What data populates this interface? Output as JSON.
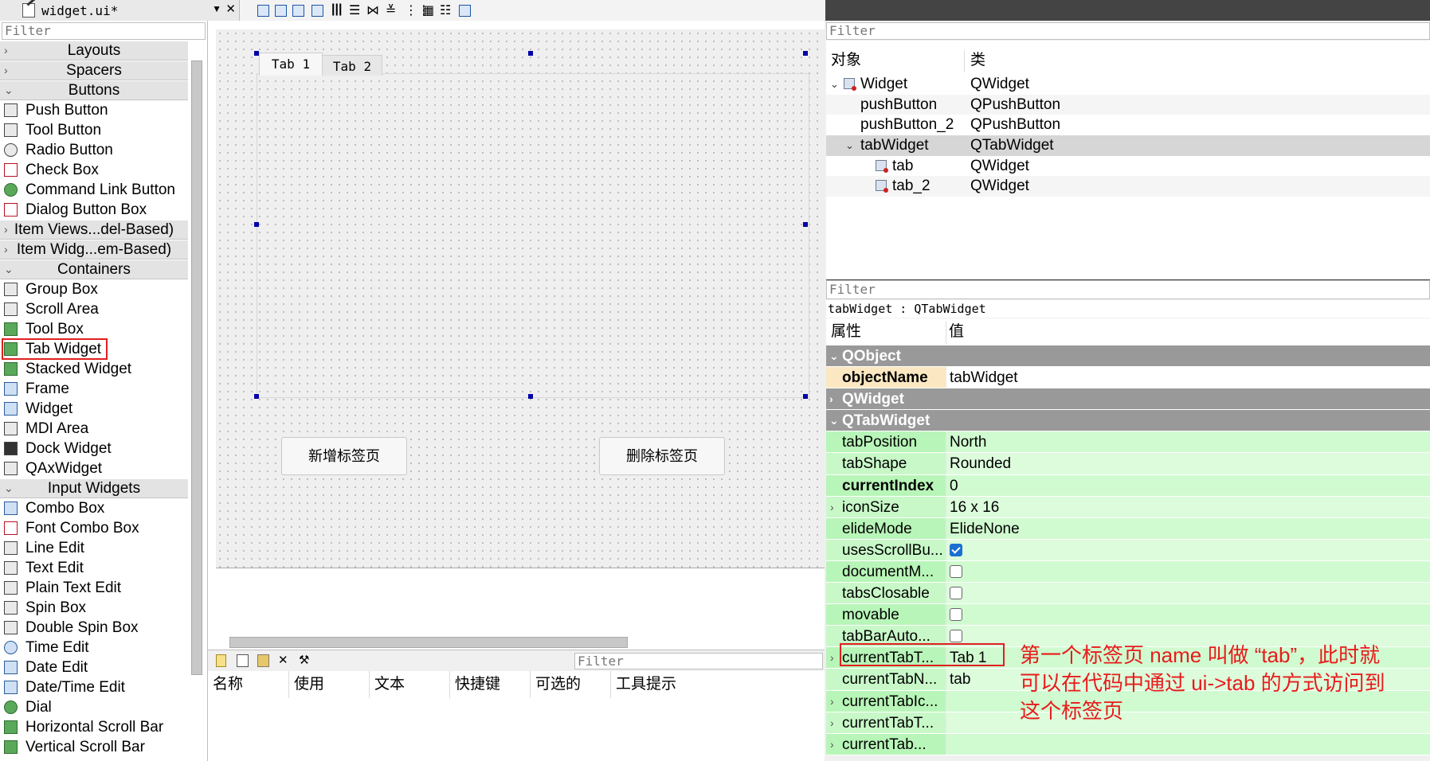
{
  "file_tab": {
    "name": "widget.ui*"
  },
  "widget_box": {
    "filter_placeholder": "Filter",
    "categories": {
      "layouts": "Layouts",
      "spacers": "Spacers",
      "buttons": "Buttons",
      "item_views": "Item Views...del-Based)",
      "item_widgets": "Item Widg...em-Based)",
      "containers": "Containers",
      "input_widgets": "Input Widgets"
    },
    "buttons": [
      "Push Button",
      "Tool Button",
      "Radio Button",
      "Check Box",
      "Command Link Button",
      "Dialog Button Box"
    ],
    "containers": [
      "Group Box",
      "Scroll Area",
      "Tool Box",
      "Tab Widget",
      "Stacked Widget",
      "Frame",
      "Widget",
      "MDI Area",
      "Dock Widget",
      "QAxWidget"
    ],
    "inputs": [
      "Combo Box",
      "Font Combo Box",
      "Line Edit",
      "Text Edit",
      "Plain Text Edit",
      "Spin Box",
      "Double Spin Box",
      "Time Edit",
      "Date Edit",
      "Date/Time Edit",
      "Dial",
      "Horizontal Scroll Bar",
      "Vertical Scroll Bar"
    ]
  },
  "form": {
    "tabs": [
      "Tab 1",
      "Tab 2"
    ],
    "add_button": "新增标签页",
    "delete_button": "删除标签页"
  },
  "action_editor": {
    "filter_placeholder": "Filter",
    "columns": [
      "名称",
      "使用",
      "文本",
      "快捷键",
      "可选的",
      "工具提示"
    ]
  },
  "object_inspector": {
    "filter_placeholder": "Filter",
    "col_object": "对象",
    "col_class": "类",
    "rows": [
      {
        "name": "Widget",
        "class": "QWidget"
      },
      {
        "name": "pushButton",
        "class": "QPushButton"
      },
      {
        "name": "pushButton_2",
        "class": "QPushButton"
      },
      {
        "name": "tabWidget",
        "class": "QTabWidget"
      },
      {
        "name": "tab",
        "class": "QWidget"
      },
      {
        "name": "tab_2",
        "class": "QWidget"
      }
    ]
  },
  "property_editor": {
    "filter_placeholder": "Filter",
    "title": "tabWidget : QTabWidget",
    "col_property": "属性",
    "col_value": "值",
    "sections": {
      "qobject": "QObject",
      "qwidget": "QWidget",
      "qtabwidget": "QTabWidget"
    },
    "object_name": {
      "name": "objectName",
      "value": "tabWidget"
    },
    "props": [
      {
        "name": "tabPosition",
        "value": "North"
      },
      {
        "name": "tabShape",
        "value": "Rounded"
      },
      {
        "name": "currentIndex",
        "value": "0"
      },
      {
        "name": "iconSize",
        "value": "16 x 16"
      },
      {
        "name": "elideMode",
        "value": "ElideNone"
      },
      {
        "name": "usesScrollBu...",
        "value": ""
      },
      {
        "name": "documentM...",
        "value": ""
      },
      {
        "name": "tabsClosable",
        "value": ""
      },
      {
        "name": "movable",
        "value": ""
      },
      {
        "name": "tabBarAuto...",
        "value": ""
      },
      {
        "name": "currentTabT...",
        "value": "Tab 1"
      },
      {
        "name": "currentTabN...",
        "value": "tab"
      },
      {
        "name": "currentTabIc...",
        "value": ""
      },
      {
        "name": "currentTabT...",
        "value": ""
      },
      {
        "name": "currentTab...",
        "value": ""
      }
    ],
    "checkbox_states": {
      "usesScrollButtons": true,
      "documentMode": false,
      "tabsClosable": false,
      "movable": false,
      "tabBarAutoHide": false
    }
  },
  "annotation": {
    "line1": "第一个标签页 name 叫做 “tab”，此时就",
    "line2": "可以在代码中通过 ui->tab 的方式访问到",
    "line3": "这个标签页"
  },
  "colors": {
    "highlight_red": "#e02020",
    "annotation_red": "#e81b1b",
    "section_gray": "#999999",
    "prop_green": "#b8f5b8",
    "handle_blue": "#0000a8"
  }
}
